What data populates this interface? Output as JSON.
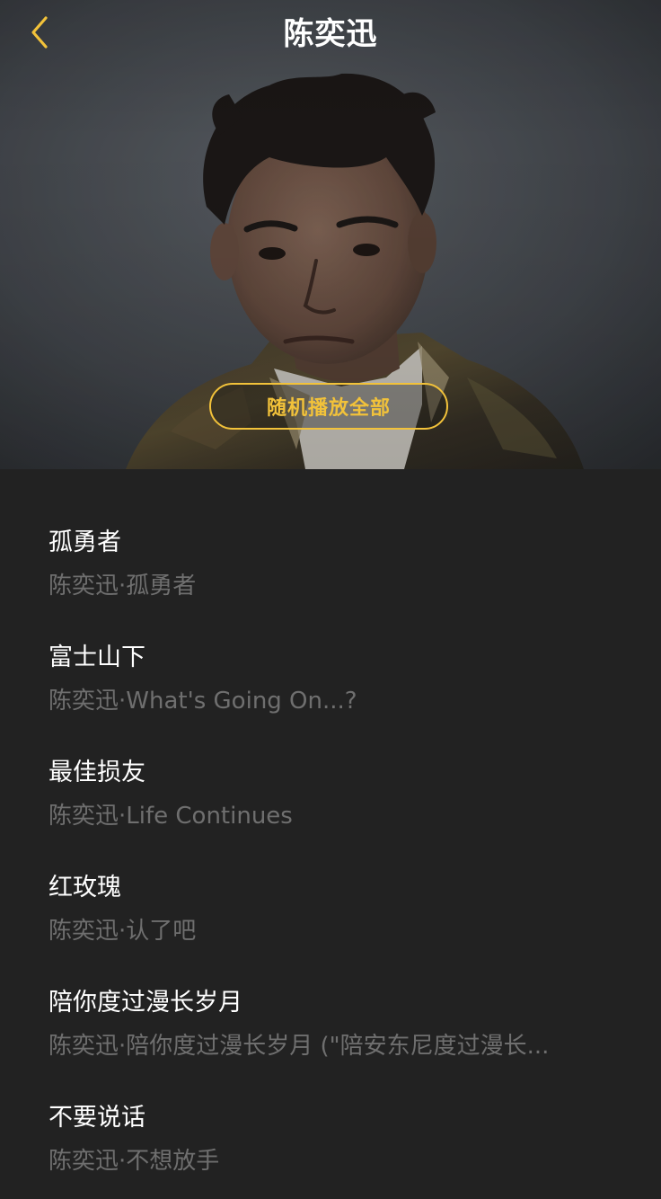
{
  "header": {
    "title": "陈奕迅",
    "back_icon": "chevron-left-icon",
    "accent_color": "#f2c23a"
  },
  "hero": {
    "shuffle_label": "随机播放全部"
  },
  "songs": [
    {
      "title": "孤勇者",
      "subtitle": "陈奕迅·孤勇者"
    },
    {
      "title": "富士山下",
      "subtitle": "陈奕迅·What's Going On...?"
    },
    {
      "title": "最佳损友",
      "subtitle": "陈奕迅·Life Continues"
    },
    {
      "title": "红玫瑰",
      "subtitle": "陈奕迅·认了吧"
    },
    {
      "title": "陪你度过漫长岁月",
      "subtitle": "陈奕迅·陪你度过漫长岁月 (\"陪安东尼度过漫长..."
    },
    {
      "title": "不要说话",
      "subtitle": "陈奕迅·不想放手"
    }
  ]
}
